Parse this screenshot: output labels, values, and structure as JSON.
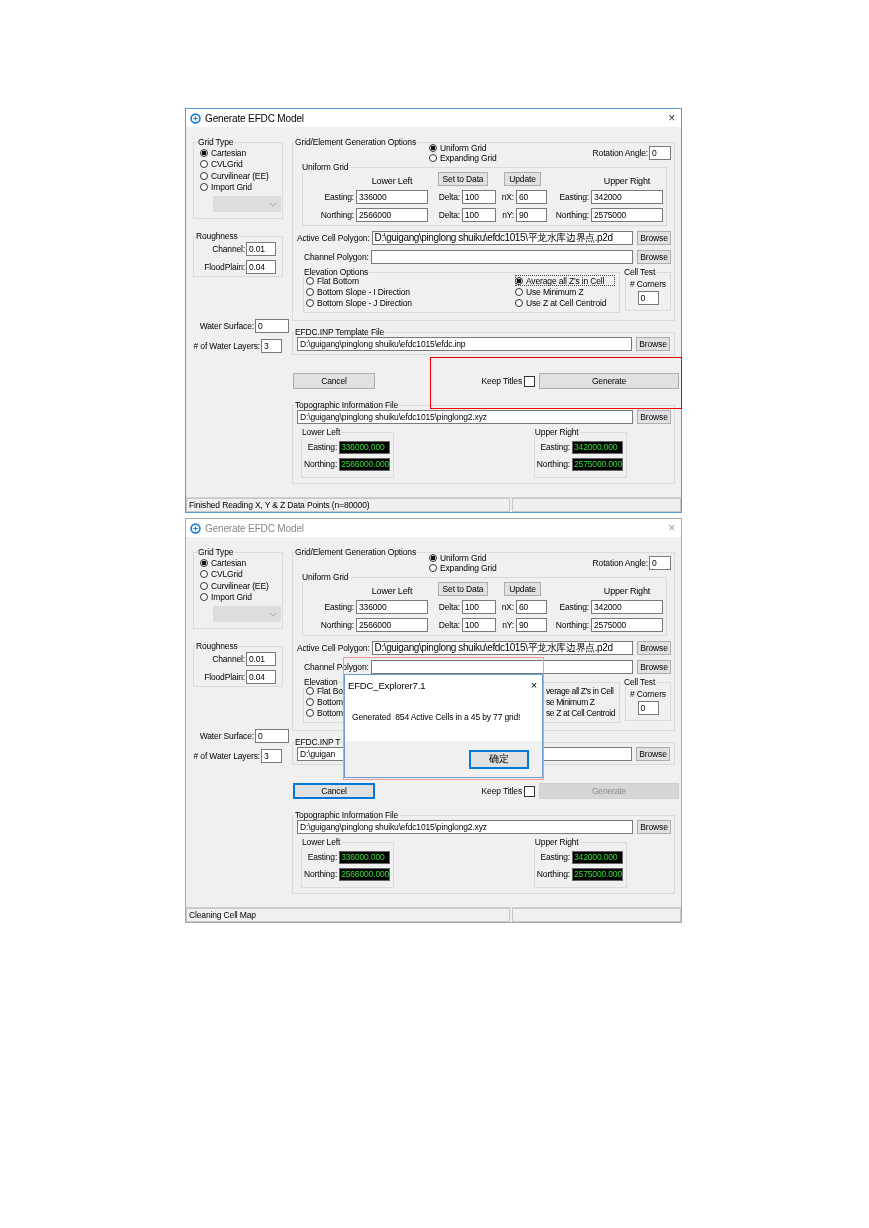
{
  "windows": [
    {
      "title": "Generate EFDC Model",
      "active": true,
      "close": "×",
      "annotation_box": true,
      "grid_type": {
        "label": "Grid Type",
        "options": [
          {
            "label": "Cartesian",
            "selected": true
          },
          {
            "label": "CVLGrid",
            "selected": false
          },
          {
            "label": "Curvilinear (EE)",
            "selected": false
          },
          {
            "label": "Import Grid",
            "selected": false
          }
        ]
      },
      "roughness": {
        "label": "Roughness",
        "channel_label": "Channel:",
        "channel": "0.01",
        "floodplain_label": "FloodPlain:",
        "floodplain": "0.04"
      },
      "water_surface_label": "Water Surface:",
      "water_surface": "0",
      "water_layers_label": "# of Water Layers:",
      "water_layers": "3",
      "generation": {
        "label": "Grid/Element Generation Options",
        "grid_modes": [
          {
            "label": "Uniform Grid",
            "selected": true
          },
          {
            "label": "Expanding Grid",
            "selected": false
          }
        ],
        "rotation_label": "Rotation Angle:",
        "rotation": "0",
        "uniform_grid": {
          "label": "Uniform Grid",
          "lower_left": "Lower Left",
          "set_to_data": "Set to Data",
          "update": "Update",
          "upper_right": "Upper Right",
          "rows": [
            {
              "ll_label": "Easting:",
              "ll_value": "336000",
              "delta_label": "Delta:",
              "delta": "100",
              "n_label": "nX:",
              "n": "60",
              "ur_label": "Easting:",
              "ur_value": "342000"
            },
            {
              "ll_label": "Northing:",
              "ll_value": "2566000",
              "delta_label": "Delta:",
              "delta": "100",
              "n_label": "nY:",
              "n": "90",
              "ur_label": "Northing:",
              "ur_value": "2575000"
            }
          ]
        },
        "active_cell": {
          "label": "Active Cell Polygon:",
          "value": "D:\\guigang\\pinglong shuiku\\efdc1015\\平龙水库边界点.p2d",
          "button": "Browse"
        },
        "channel": {
          "label": "Channel Polygon:",
          "button": "Browse"
        },
        "elevation": {
          "label": "Elevation Options",
          "left": [
            {
              "label": "Flat Bottom",
              "selected": false
            },
            {
              "label": "Bottom Slope - I Direction",
              "selected": false
            },
            {
              "label": "Bottom Slope - J Direction",
              "selected": false
            }
          ],
          "right": [
            {
              "label": "Average all Z's in Cell",
              "selected": true
            },
            {
              "label": "Use Minimum Z",
              "selected": false
            },
            {
              "label": "Use Z at Cell Centroid",
              "selected": false
            }
          ]
        },
        "cell_test": {
          "label": "Cell Test",
          "corners_label": "# Corners",
          "corners": "0"
        }
      },
      "template": {
        "label": "EFDC.INP Template File",
        "value": "D:\\guigang\\pinglong shuiku\\efdc1015\\efdc.inp",
        "button": "Browse"
      },
      "cancel": {
        "label": "Cancel",
        "focused": false
      },
      "keep_titles": {
        "label": "Keep Titles",
        "checked": false
      },
      "generate": {
        "label": "Generate",
        "disabled": false
      },
      "topo": {
        "label": "Topographic Information File",
        "value": "D:\\guigang\\pinglong shuiku\\efdc1015\\pinglong2.xyz",
        "button": "Browse",
        "lower_left": {
          "label": "Lower Left",
          "easting_label": "Easting:",
          "easting": "336000.000",
          "northing_label": "Northing:",
          "northing": "2566000.000"
        },
        "upper_right": {
          "label": "Upper Right",
          "easting_label": "Easting:",
          "easting": "342000.000",
          "northing_label": "Northing:",
          "northing": "2575000.000"
        }
      },
      "status": "Finished Reading X, Y & Z Data Points (n=80000)"
    },
    {
      "title": "Generate EFDC Model",
      "active": false,
      "close": "×",
      "annotation_box": false,
      "grid_type": {
        "label": "Grid Type",
        "options": [
          {
            "label": "Cartesian",
            "selected": true
          },
          {
            "label": "CVLGrid",
            "selected": false
          },
          {
            "label": "Curvilinear (EE)",
            "selected": false
          },
          {
            "label": "Import Grid",
            "selected": false
          }
        ]
      },
      "roughness": {
        "label": "Roughness",
        "channel_label": "Channel:",
        "channel": "0.01",
        "floodplain_label": "FloodPlain:",
        "floodplain": "0.04"
      },
      "water_surface_label": "Water Surface:",
      "water_surface": "0",
      "water_layers_label": "# of Water Layers:",
      "water_layers": "3",
      "generation": {
        "label": "Grid/Element Generation Options",
        "grid_modes": [
          {
            "label": "Uniform Grid",
            "selected": true
          },
          {
            "label": "Expanding Grid",
            "selected": false
          }
        ],
        "rotation_label": "Rotation Angle:",
        "rotation": "0",
        "uniform_grid": {
          "label": "Uniform Grid",
          "lower_left": "Lower Left",
          "set_to_data": "Set to Data",
          "update": "Update",
          "upper_right": "Upper Right",
          "rows": [
            {
              "ll_label": "Easting:",
              "ll_value": "336000",
              "delta_label": "Delta:",
              "delta": "100",
              "n_label": "nX:",
              "n": "60",
              "ur_label": "Easting:",
              "ur_value": "342000"
            },
            {
              "ll_label": "Northing:",
              "ll_value": "2566000",
              "delta_label": "Delta:",
              "delta": "100",
              "n_label": "nY:",
              "n": "90",
              "ur_label": "Northing:",
              "ur_value": "2575000"
            }
          ]
        },
        "active_cell": {
          "label": "Active Cell Polygon:",
          "value": "D:\\guigang\\pinglong shuiku\\efdc1015\\平龙水库边界点.p2d",
          "button": "Browse"
        },
        "channel": {
          "label": "Channel Polygon:",
          "button": "Browse"
        },
        "elevation": {
          "label": "Elevation",
          "left": [
            {
              "label": "Flat Bo",
              "selected": false
            },
            {
              "label": "Bottom",
              "selected": false
            },
            {
              "label": "Bottom",
              "selected": false
            }
          ],
          "right": [
            {
              "label": "verage all Z's in Cell"
            },
            {
              "label": "se Minimum Z"
            },
            {
              "label": "se Z at Cell Centroid"
            }
          ]
        },
        "cell_test": {
          "label": "Cell Test",
          "corners_label": "# Corners",
          "corners": "0"
        }
      },
      "template": {
        "label": "EFDC.INP T",
        "value": "D:\\guigan",
        "button": "Browse"
      },
      "cancel": {
        "label": "Cancel",
        "focused": true
      },
      "keep_titles": {
        "label": "Keep Titles",
        "checked": false
      },
      "generate": {
        "label": "Generate",
        "disabled": true
      },
      "topo": {
        "label": "Topographic Information File",
        "value": "D:\\guigang\\pinglong shuiku\\efdc1015\\pinglong2.xyz",
        "button": "Browse",
        "lower_left": {
          "label": "Lower Left",
          "easting_label": "Easting:",
          "easting": "336000.000",
          "northing_label": "Northing:",
          "northing": "2566000.000"
        },
        "upper_right": {
          "label": "Upper Right",
          "easting_label": "Easting:",
          "easting": "342000.000",
          "northing_label": "Northing:",
          "northing": "2575000.000"
        }
      },
      "status": "Cleaning Cell Map",
      "message_box": {
        "title": "EFDC_Explorer7.1",
        "close": "×",
        "text": "Generated  854 Active Cells in a 45 by 77 grid!",
        "button": "确定"
      }
    }
  ]
}
